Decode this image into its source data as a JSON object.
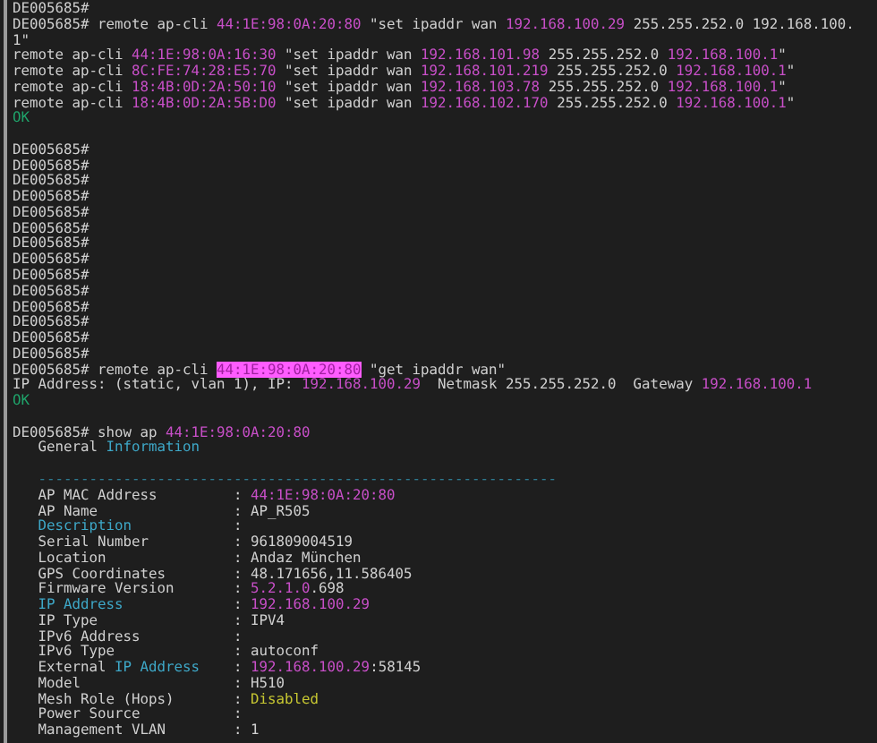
{
  "terminal": {
    "lines": [
      {
        "kind": "text",
        "segments": [
          {
            "text": "DE005685#",
            "kind": "plain"
          }
        ]
      },
      {
        "kind": "text",
        "segments": [
          {
            "text": "DE005685# remote ap-cli ",
            "kind": "plain"
          },
          {
            "text": "44:1E:98:0A:20:80",
            "kind": "magenta"
          },
          {
            "text": " \"set ipaddr wan ",
            "kind": "plain"
          },
          {
            "text": "192.168.100.29",
            "kind": "magenta"
          },
          {
            "text": " 255.255.252.0 192.168.100.",
            "kind": "plain"
          }
        ]
      },
      {
        "kind": "text",
        "segments": [
          {
            "text": "1\"",
            "kind": "plain"
          }
        ]
      },
      {
        "kind": "text",
        "segments": [
          {
            "text": "remote ap-cli ",
            "kind": "plain"
          },
          {
            "text": "44:1E:98:0A:16:30",
            "kind": "magenta"
          },
          {
            "text": " \"set ipaddr wan ",
            "kind": "plain"
          },
          {
            "text": "192.168.101.98",
            "kind": "magenta"
          },
          {
            "text": " 255.255.252.0 ",
            "kind": "plain"
          },
          {
            "text": "192.168.100.1",
            "kind": "magenta"
          },
          {
            "text": "\"",
            "kind": "plain"
          }
        ]
      },
      {
        "kind": "text",
        "segments": [
          {
            "text": "remote ap-cli ",
            "kind": "plain"
          },
          {
            "text": "8C:FE:74:28:E5:70",
            "kind": "magenta"
          },
          {
            "text": " \"set ipaddr wan ",
            "kind": "plain"
          },
          {
            "text": "192.168.101.219",
            "kind": "magenta"
          },
          {
            "text": " 255.255.252.0 ",
            "kind": "plain"
          },
          {
            "text": "192.168.100.1",
            "kind": "magenta"
          },
          {
            "text": "\"",
            "kind": "plain"
          }
        ]
      },
      {
        "kind": "text",
        "segments": [
          {
            "text": "remote ap-cli ",
            "kind": "plain"
          },
          {
            "text": "18:4B:0D:2A:50:10",
            "kind": "magenta"
          },
          {
            "text": " \"set ipaddr wan ",
            "kind": "plain"
          },
          {
            "text": "192.168.103.78",
            "kind": "magenta"
          },
          {
            "text": " 255.255.252.0 ",
            "kind": "plain"
          },
          {
            "text": "192.168.100.1",
            "kind": "magenta"
          },
          {
            "text": "\"",
            "kind": "plain"
          }
        ]
      },
      {
        "kind": "text",
        "segments": [
          {
            "text": "remote ap-cli ",
            "kind": "plain"
          },
          {
            "text": "18:4B:0D:2A:5B:D0",
            "kind": "magenta"
          },
          {
            "text": " \"set ipaddr wan ",
            "kind": "plain"
          },
          {
            "text": "192.168.102.170",
            "kind": "magenta"
          },
          {
            "text": " 255.255.252.0 ",
            "kind": "plain"
          },
          {
            "text": "192.168.100.1",
            "kind": "magenta"
          },
          {
            "text": "\"",
            "kind": "plain"
          }
        ]
      },
      {
        "kind": "text",
        "segments": [
          {
            "text": "OK",
            "kind": "green"
          }
        ]
      },
      {
        "kind": "blank"
      },
      {
        "kind": "text",
        "segments": [
          {
            "text": "DE005685#",
            "kind": "plain"
          }
        ]
      },
      {
        "kind": "text",
        "segments": [
          {
            "text": "DE005685#",
            "kind": "plain"
          }
        ]
      },
      {
        "kind": "text",
        "segments": [
          {
            "text": "DE005685#",
            "kind": "plain"
          }
        ]
      },
      {
        "kind": "text",
        "segments": [
          {
            "text": "DE005685#",
            "kind": "plain"
          }
        ]
      },
      {
        "kind": "text",
        "segments": [
          {
            "text": "DE005685#",
            "kind": "plain"
          }
        ]
      },
      {
        "kind": "text",
        "segments": [
          {
            "text": "DE005685#",
            "kind": "plain"
          }
        ]
      },
      {
        "kind": "text",
        "segments": [
          {
            "text": "DE005685#",
            "kind": "plain"
          }
        ]
      },
      {
        "kind": "text",
        "segments": [
          {
            "text": "DE005685#",
            "kind": "plain"
          }
        ]
      },
      {
        "kind": "text",
        "segments": [
          {
            "text": "DE005685#",
            "kind": "plain"
          }
        ]
      },
      {
        "kind": "text",
        "segments": [
          {
            "text": "DE005685#",
            "kind": "plain"
          }
        ]
      },
      {
        "kind": "text",
        "segments": [
          {
            "text": "DE005685#",
            "kind": "plain"
          }
        ]
      },
      {
        "kind": "text",
        "segments": [
          {
            "text": "DE005685#",
            "kind": "plain"
          }
        ]
      },
      {
        "kind": "text",
        "segments": [
          {
            "text": "DE005685#",
            "kind": "plain"
          }
        ]
      },
      {
        "kind": "text",
        "segments": [
          {
            "text": "DE005685#",
            "kind": "plain"
          }
        ]
      },
      {
        "kind": "text",
        "segments": [
          {
            "text": "DE005685# remote ap-cli ",
            "kind": "plain"
          },
          {
            "text": "44:1E:98:0A:20:80",
            "kind": "highlight"
          },
          {
            "text": " \"get ipaddr wan\"",
            "kind": "plain"
          }
        ]
      },
      {
        "kind": "text",
        "segments": [
          {
            "text": "IP Address: (static, vlan 1), IP: ",
            "kind": "plain"
          },
          {
            "text": "192.168.100.29",
            "kind": "magenta"
          },
          {
            "text": "  Netmask 255.255.252.0  Gateway ",
            "kind": "plain"
          },
          {
            "text": "192.168.100.1",
            "kind": "magenta"
          }
        ]
      },
      {
        "kind": "text",
        "segments": [
          {
            "text": "OK",
            "kind": "green"
          }
        ]
      },
      {
        "kind": "blank"
      },
      {
        "kind": "text",
        "segments": [
          {
            "text": "DE005685# show ap ",
            "kind": "plain"
          },
          {
            "text": "44:1E:98:0A:20:80",
            "kind": "magenta"
          }
        ]
      },
      {
        "kind": "text",
        "segments": [
          {
            "text": "   General ",
            "kind": "plain"
          },
          {
            "text": "Information",
            "kind": "cyan"
          }
        ]
      },
      {
        "kind": "blank"
      },
      {
        "kind": "text",
        "segments": [
          {
            "text": "   -------------------------------------------------------------",
            "kind": "dim"
          }
        ]
      },
      {
        "kind": "text",
        "segments": [
          {
            "text": "   AP MAC Address         : ",
            "kind": "plain"
          },
          {
            "text": "44:1E:98:0A:20:80",
            "kind": "magenta"
          }
        ]
      },
      {
        "kind": "text",
        "segments": [
          {
            "text": "   AP Name                : AP_R505",
            "kind": "plain"
          }
        ]
      },
      {
        "kind": "text",
        "indent": true,
        "segments": [
          {
            "text": "Description",
            "kind": "cyan"
          },
          {
            "text": "            :",
            "kind": "plain"
          }
        ]
      },
      {
        "kind": "text",
        "segments": [
          {
            "text": "   Serial Number          : 961809004519",
            "kind": "plain"
          }
        ]
      },
      {
        "kind": "text",
        "segments": [
          {
            "text": "   Location               : Andaz München",
            "kind": "plain"
          }
        ]
      },
      {
        "kind": "text",
        "segments": [
          {
            "text": "   GPS Coordinates        : 48.171656,11.586405",
            "kind": "plain"
          }
        ]
      },
      {
        "kind": "text",
        "segments": [
          {
            "text": "   Firmware Version       : ",
            "kind": "plain"
          },
          {
            "text": "5.2.1.0",
            "kind": "magenta"
          },
          {
            "text": ".698",
            "kind": "plain"
          }
        ]
      },
      {
        "kind": "text",
        "indent": true,
        "segments": [
          {
            "text": "IP Address",
            "kind": "cyan"
          },
          {
            "text": "             : ",
            "kind": "plain"
          },
          {
            "text": "192.168.100.29",
            "kind": "magenta"
          }
        ]
      },
      {
        "kind": "text",
        "segments": [
          {
            "text": "   IP Type                : IPV4",
            "kind": "plain"
          }
        ]
      },
      {
        "kind": "text",
        "segments": [
          {
            "text": "   IPv6 Address           :",
            "kind": "plain"
          }
        ]
      },
      {
        "kind": "text",
        "segments": [
          {
            "text": "   IPv6 Type              : autoconf",
            "kind": "plain"
          }
        ]
      },
      {
        "kind": "text",
        "segments": [
          {
            "text": "   External ",
            "kind": "plain"
          },
          {
            "text": "IP Address",
            "kind": "cyan"
          },
          {
            "text": "    : ",
            "kind": "plain"
          },
          {
            "text": "192.168.100.29",
            "kind": "magenta"
          },
          {
            "text": ":58145",
            "kind": "plain"
          }
        ]
      },
      {
        "kind": "text",
        "segments": [
          {
            "text": "   Model                  : H510",
            "kind": "plain"
          }
        ]
      },
      {
        "kind": "text",
        "segments": [
          {
            "text": "   Mesh Role (Hops)       : ",
            "kind": "plain"
          },
          {
            "text": "Disabled",
            "kind": "yellow"
          }
        ]
      },
      {
        "kind": "text",
        "segments": [
          {
            "text": "   Power Source           :",
            "kind": "plain"
          }
        ]
      },
      {
        "kind": "text",
        "segments": [
          {
            "text": "   Management VLAN        : 1",
            "kind": "plain"
          }
        ]
      }
    ]
  }
}
